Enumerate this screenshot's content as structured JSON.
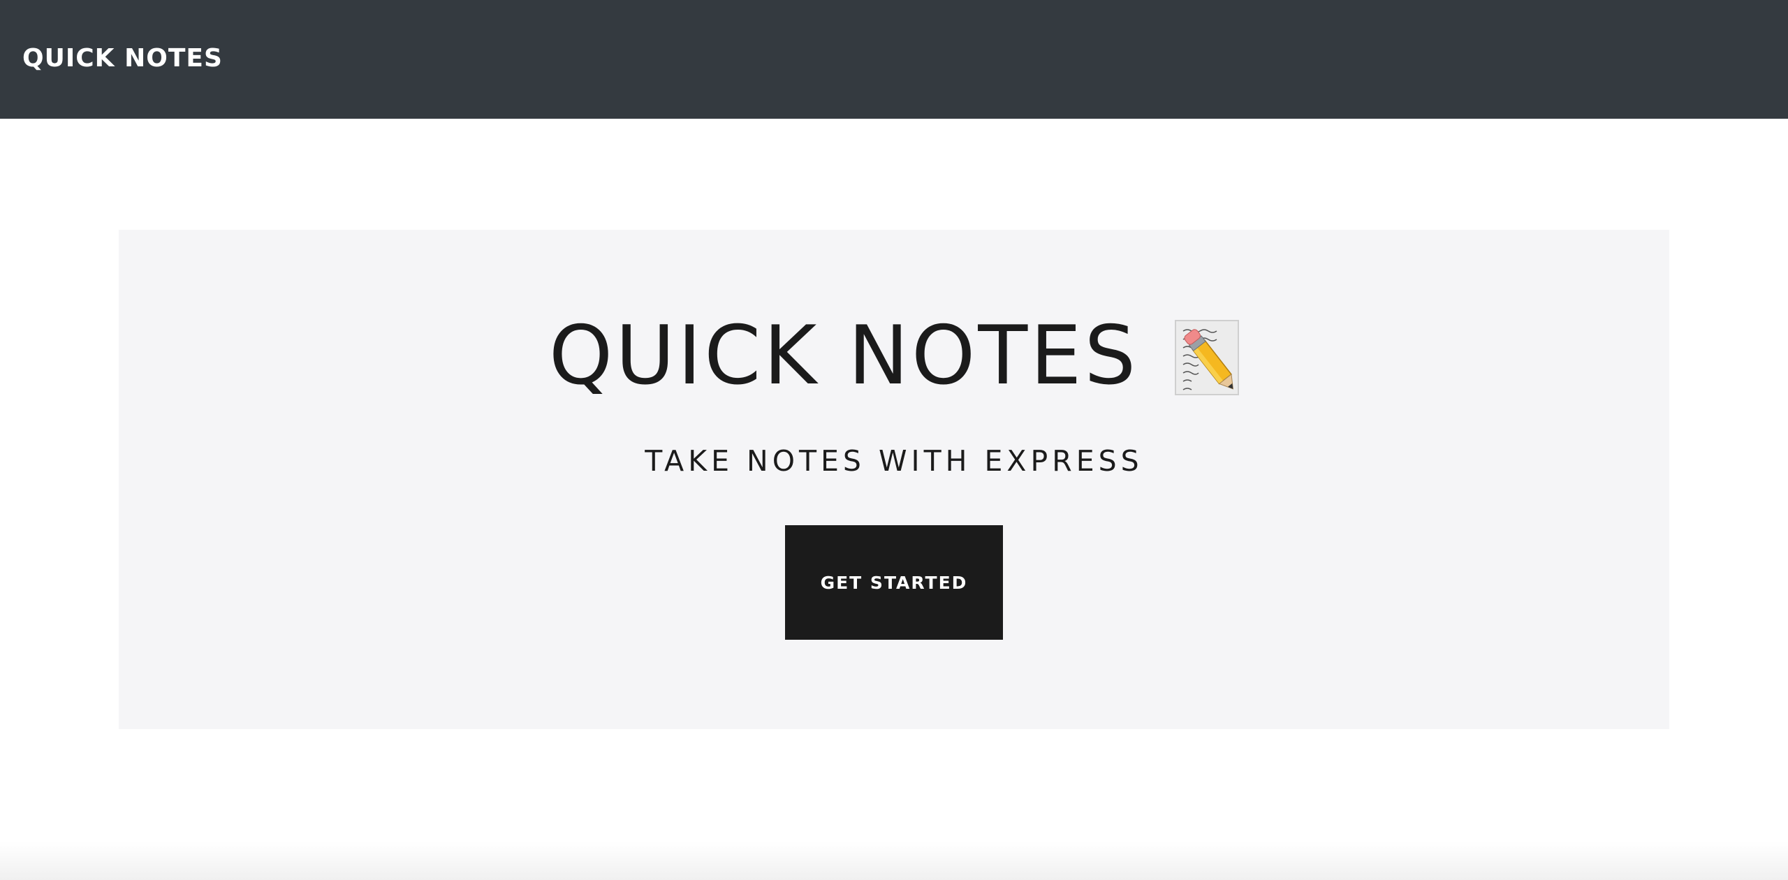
{
  "navbar": {
    "brand": "QUICK NOTES",
    "background_color": "#343a40"
  },
  "hero": {
    "title": "QUICK NOTES",
    "title_icon": "memo-icon",
    "subtitle": "TAKE NOTES WITH EXPRESS",
    "cta_label": "GET STARTED",
    "background_color": "#f5f5f7",
    "cta_color": "#1b1b1b"
  }
}
